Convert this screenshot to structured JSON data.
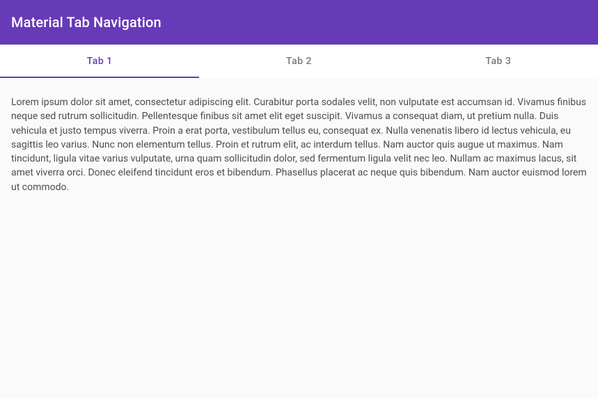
{
  "header": {
    "title": "Material Tab Navigation"
  },
  "tabs": [
    {
      "label": "Tab 1",
      "active": true
    },
    {
      "label": "Tab 2",
      "active": false
    },
    {
      "label": "Tab 3",
      "active": false
    }
  ],
  "content": {
    "tab1_body": "Lorem ipsum dolor sit amet, consectetur adipiscing elit. Curabitur porta sodales velit, non vulputate est accumsan id. Vivamus finibus neque sed rutrum sollicitudin. Pellentesque finibus sit amet elit eget suscipit. Vivamus a consequat diam, ut pretium nulla. Duis vehicula et justo tempus viverra. Proin a erat porta, vestibulum tellus eu, consequat ex. Nulla venenatis libero id lectus vehicula, eu sagittis leo varius. Nunc non elementum tellus. Proin et rutrum elit, ac interdum tellus. Nam auctor quis augue ut maximus. Nam tincidunt, ligula vitae varius vulputate, urna quam sollicitudin dolor, sed fermentum ligula velit nec leo. Nullam ac maximus lacus, sit amet viverra orci. Donec eleifend tincidunt eros et bibendum. Phasellus placerat ac neque quis bibendum. Nam auctor euismod lorem ut commodo."
  },
  "colors": {
    "primary": "#673ab7",
    "text_secondary": "rgba(0,0,0,0.54)"
  }
}
